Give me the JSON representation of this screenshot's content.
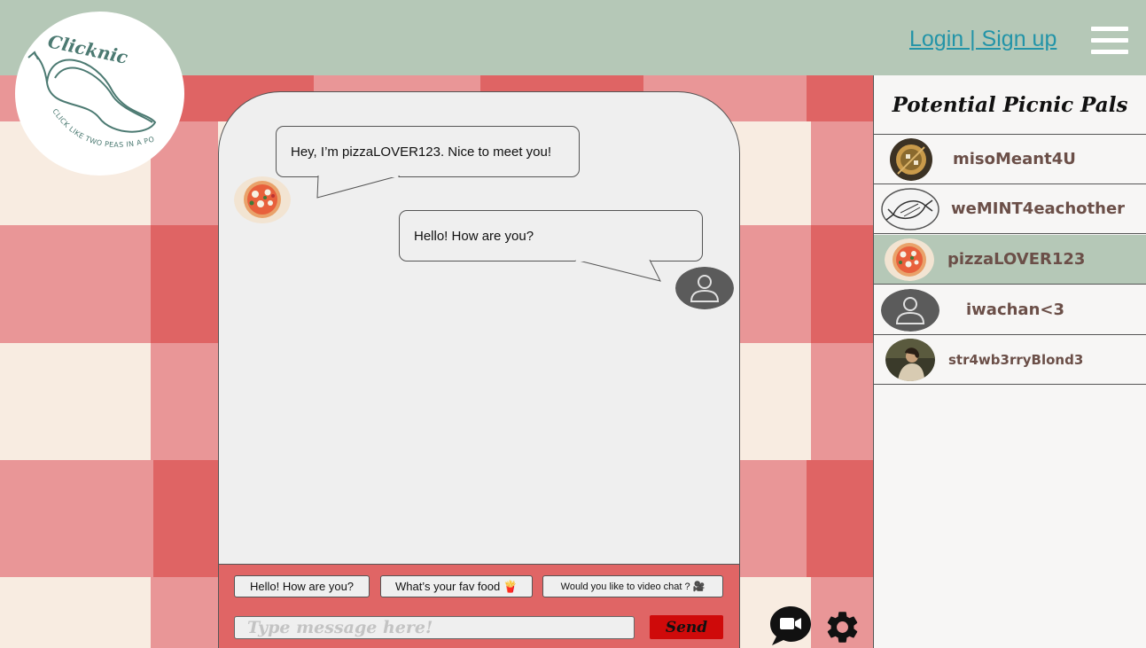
{
  "header": {
    "auth_link": "Login | Sign up",
    "menu_icon": "hamburger-menu-icon",
    "background": "#b5c8b7",
    "link_color": "#2394a8"
  },
  "logo": {
    "brand": "Clicknic",
    "tagline": "CLICK LIKE TWO PEAS IN A POD",
    "icon": "pea-pod-logo-icon",
    "color": "#4c7a72"
  },
  "chat": {
    "messages": [
      {
        "sender": "other",
        "text": "Hey, I’m pizzaLOVER123. Nice to meet you!",
        "avatar": "pizza-avatar"
      },
      {
        "sender": "self",
        "text": "Hello! How are you?",
        "avatar": "default-user-avatar"
      }
    ],
    "quick_replies": [
      "Hello! How are you?",
      "What’s your fav food 🍟",
      "Would you like to video chat ? 🎥"
    ],
    "input_placeholder": "Type message here!",
    "input_value": "",
    "send_label": "Send",
    "footer_color": "#e06565",
    "send_color": "#cf0a0a"
  },
  "bottom_icons": [
    "video-chat-icon",
    "gear-icon"
  ],
  "sidebar": {
    "title": "Potential Picnic Pals",
    "pals": [
      {
        "name": "misoMeant4U",
        "avatar": "miso-soup-avatar",
        "active": false
      },
      {
        "name": "weMINT4eachother",
        "avatar": "mint-candy-avatar",
        "active": false
      },
      {
        "name": "pizzaLOVER123",
        "avatar": "pizza-avatar",
        "active": true
      },
      {
        "name": "iwachan<3",
        "avatar": "default-user-avatar",
        "active": false
      },
      {
        "name": "str4wb3rryBlond3",
        "avatar": "photo-avatar",
        "active": false
      }
    ],
    "active_color": "#b5c8b7"
  },
  "background_colors": {
    "light": "#f8ece1",
    "mid": "#e99697",
    "dark": "#df6464"
  }
}
